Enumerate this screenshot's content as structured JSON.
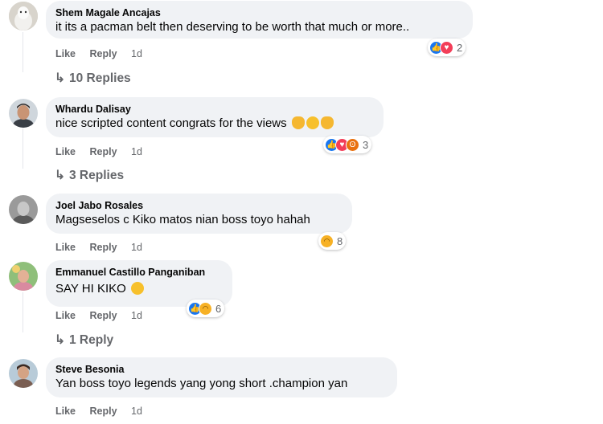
{
  "comments": [
    {
      "author": "Shem Magale Ancajas",
      "text": "it its a pacman belt then deserving to be worth that much or more..",
      "like": "Like",
      "reply": "Reply",
      "time": "1d",
      "reaction_count": "2",
      "replies_label": "10 Replies"
    },
    {
      "author": "Whardu Dalisay",
      "text": "nice scripted content congrats for the views",
      "like": "Like",
      "reply": "Reply",
      "time": "1d",
      "reaction_count": "3",
      "replies_label": "3 Replies"
    },
    {
      "author": "Joel Jabo Rosales",
      "text": "Magseselos c Kiko matos nian boss toyo hahah",
      "like": "Like",
      "reply": "Reply",
      "time": "1d",
      "reaction_count": "8"
    },
    {
      "author": "Emmanuel Castillo Panganiban",
      "text": "SAY HI KIKO",
      "like": "Like",
      "reply": "Reply",
      "time": "1d",
      "reaction_count": "6",
      "replies_label": "1 Reply"
    },
    {
      "author": "Steve Besonia",
      "text": "Yan boss toyo legends yang yong short .champion yan",
      "like": "Like",
      "reply": "Reply",
      "time": "1d"
    }
  ],
  "colors": {
    "bubble": "#f0f2f5",
    "meta": "#65676b",
    "like": "#1877f2",
    "love": "#f33e58",
    "haha": "#f7b125",
    "angry": "#e9710f"
  }
}
